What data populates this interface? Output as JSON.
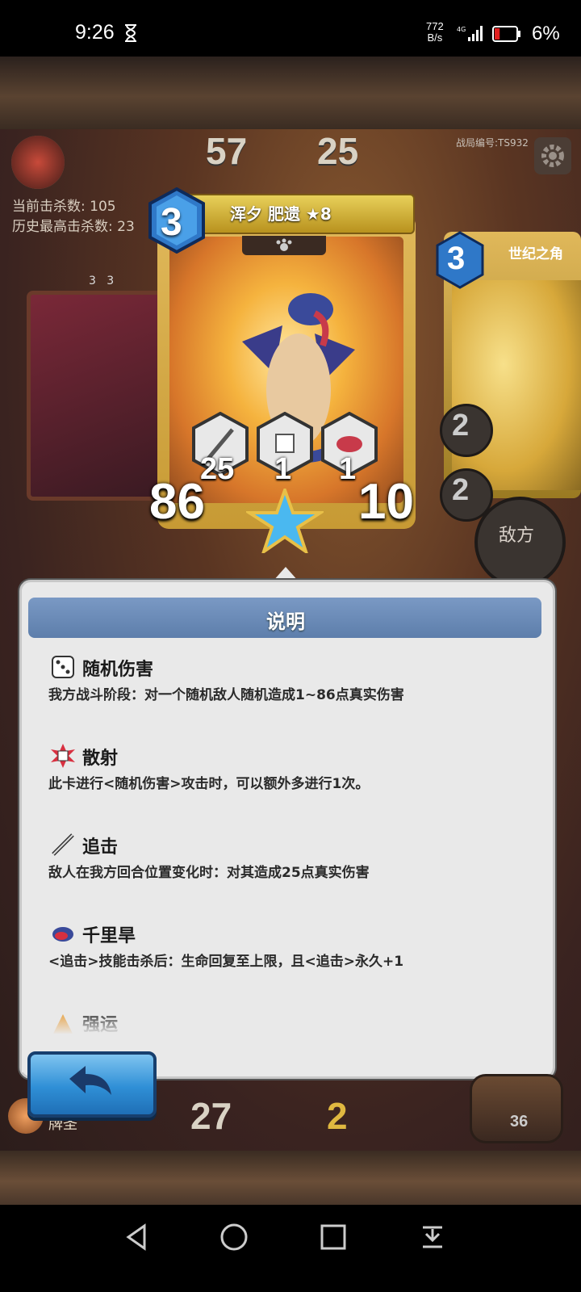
{
  "status_bar": {
    "time": "9:26",
    "net_speed_value": "772",
    "net_speed_unit": "B/s",
    "network": "4G",
    "battery_percent": "6%",
    "battery_level": 0.06
  },
  "game": {
    "score_left_top": "57",
    "score_right_top": "25",
    "battle_id": "战局编号:TS932",
    "current_kills": "当前击杀数: 105",
    "best_kills": "历史最高击杀数: 23",
    "left_card_stats": [
      "3",
      "3"
    ],
    "main_card": {
      "cost": "3",
      "title": "浑夕 肥遗 ★8",
      "skill_values": [
        "25",
        "1",
        "1"
      ],
      "attack": "86",
      "health": "10"
    },
    "right_card": {
      "cost": "3",
      "title": "世纪之角",
      "values": [
        "2",
        "2"
      ]
    },
    "enemy_label": "敌方",
    "bottom_score_left": "27",
    "bottom_score_right": "2",
    "player_name": "牌圣",
    "barrel_count": "36"
  },
  "popup": {
    "title": "说明",
    "skills": [
      {
        "icon": "dice-icon",
        "name": "随机伤害",
        "desc": "我方战斗阶段：对一个随机敌人随机造成1~86点真实伤害"
      },
      {
        "icon": "burst-dice-icon",
        "name": "散射",
        "desc": "此卡进行<随机伤害>攻击时，可以额外多进行1次。"
      },
      {
        "icon": "dagger-icon",
        "name": "追击",
        "desc": "敌人在我方回合位置变化时：对其造成25点真实伤害"
      },
      {
        "icon": "fish-icon",
        "name": "千里旱",
        "desc": "<追击>技能击杀后：生命回复至上限，且<追击>永久+1"
      },
      {
        "icon": "luck-icon",
        "name": "强运",
        "desc": ""
      }
    ]
  },
  "colors": {
    "popup_header": "#6a8bb7",
    "card_gold": "#d8ae48",
    "back_button": "#2f8fd6"
  }
}
